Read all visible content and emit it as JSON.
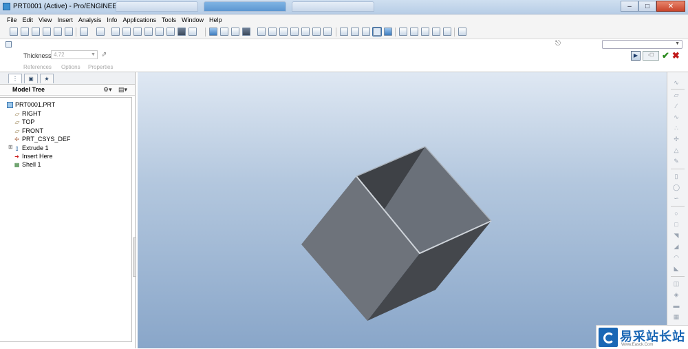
{
  "window": {
    "title": "PRT0001 (Active) - Pro/ENGINEER"
  },
  "menu": [
    "File",
    "Edit",
    "View",
    "Insert",
    "Analysis",
    "Info",
    "Applications",
    "Tools",
    "Window",
    "Help"
  ],
  "dashboard": {
    "thickness_label": "Thickness",
    "thickness_value": "4.72",
    "tabs": [
      "References",
      "Options",
      "Properties"
    ],
    "preview_label": "◦☐dd",
    "ok_symbol": "✔",
    "cancel_symbol": "✖"
  },
  "model_tree": {
    "title": "Model Tree",
    "items": [
      {
        "label": "PRT0001.PRT",
        "icon": "part-icon"
      },
      {
        "label": "RIGHT",
        "icon": "datum-plane-icon"
      },
      {
        "label": "TOP",
        "icon": "datum-plane-icon"
      },
      {
        "label": "FRONT",
        "icon": "datum-plane-icon"
      },
      {
        "label": "PRT_CSYS_DEF",
        "icon": "csys-icon"
      },
      {
        "label": "Extrude 1",
        "icon": "extrude-icon"
      },
      {
        "label": "Insert Here",
        "icon": "insert-arrow-icon"
      },
      {
        "label": "Shell 1",
        "icon": "shell-icon"
      }
    ]
  },
  "watermark": {
    "text": "易采站长站",
    "sub": "Www.Easck.Com"
  },
  "colors": {
    "face_light": "#6e737b",
    "face_dark": "#44474c",
    "inner_light": "#6a7079",
    "inner_dark": "#3e4146",
    "edge": "#cfd4da"
  }
}
